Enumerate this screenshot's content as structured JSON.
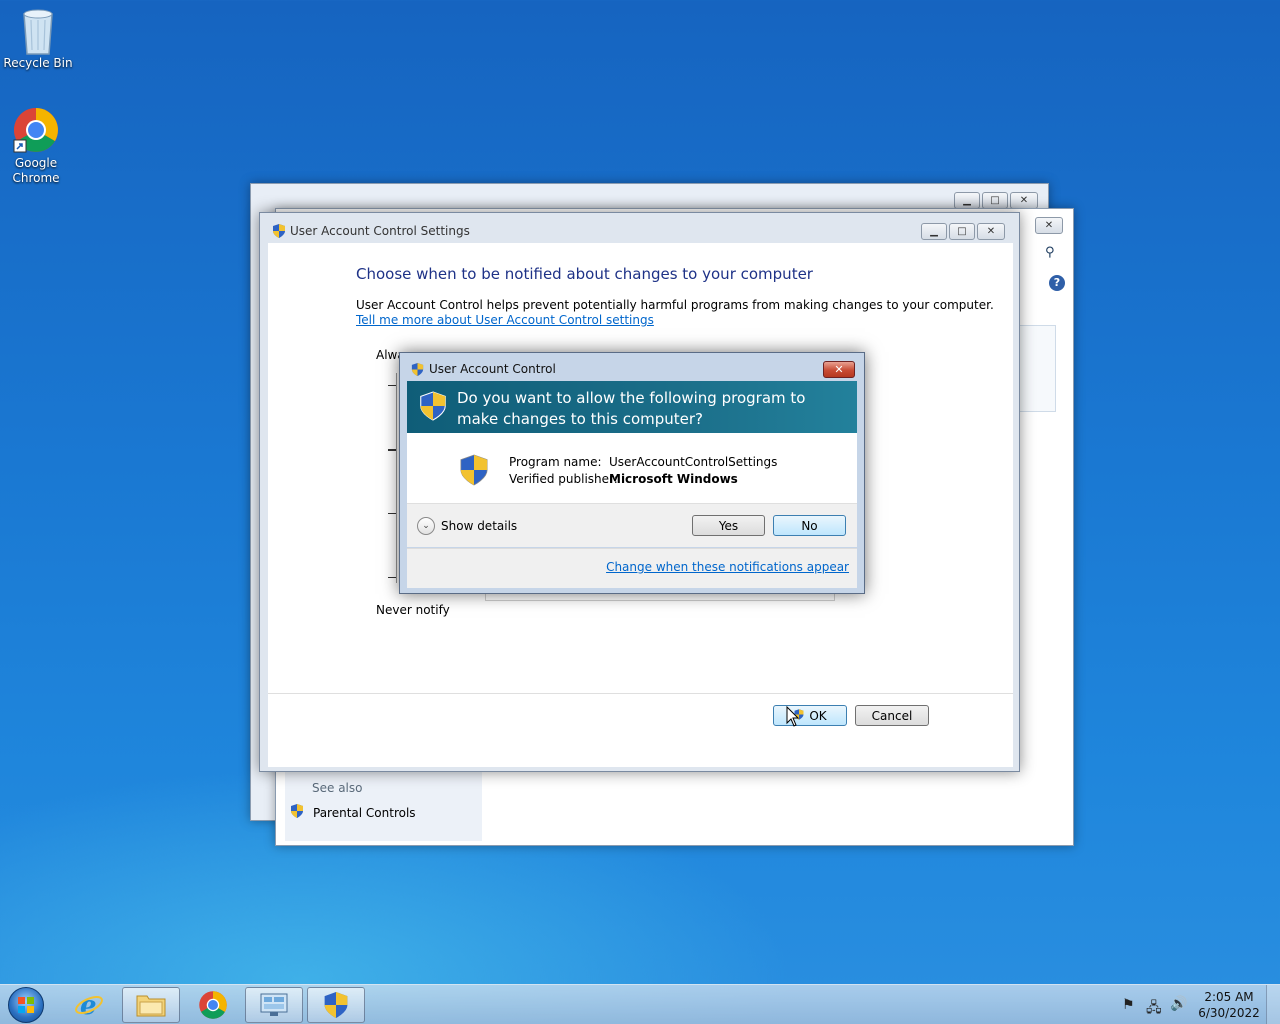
{
  "desktop": {
    "icons": [
      {
        "label": "Recycle Bin"
      },
      {
        "label_line1": "Google",
        "label_line2": "Chrome"
      }
    ]
  },
  "main_window": {
    "title": "User Account Control Settings",
    "heading": "Choose when to be notified about changes to your computer",
    "description": "User Account Control helps prevent potentially harmful programs from making changes to your computer.",
    "link": "Tell me more about User Account Control settings",
    "slider_top_label": "Alwa",
    "slider_bottom_label": "Never notify",
    "ok_label": "OK",
    "cancel_label": "Cancel"
  },
  "bg_window": {
    "see_also": "See also",
    "parental_controls": "Parental Controls"
  },
  "uac_dialog": {
    "title": "User Account Control",
    "question": "Do you want to allow the following program to make changes to this computer?",
    "program_name_label": "Program name:",
    "program_name_value": "UserAccountControlSettings",
    "publisher_label": "Verified publisher:",
    "publisher_value": "Microsoft Windows",
    "show_details": "Show details",
    "yes_label": "Yes",
    "no_label": "No",
    "change_link": "Change when these notifications appear"
  },
  "taskbar": {
    "time": "2:05 AM",
    "date": "6/30/2022"
  },
  "colors": {
    "banner": "#1b6e89",
    "heading": "#1e3287",
    "link": "#0066cc"
  }
}
